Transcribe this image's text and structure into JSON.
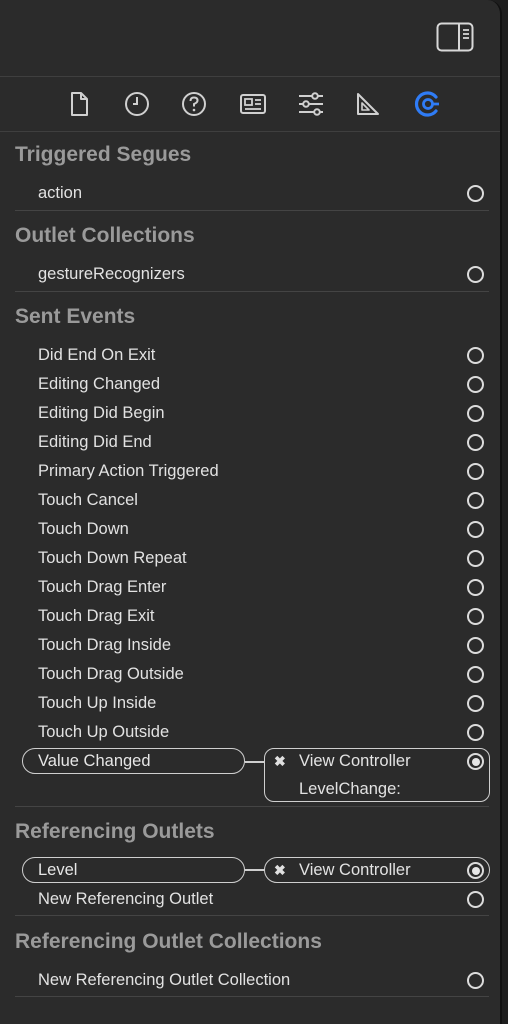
{
  "sections": {
    "triggered_segues": {
      "title": "Triggered Segues",
      "items": [
        "action"
      ]
    },
    "outlet_collections": {
      "title": "Outlet Collections",
      "items": [
        "gestureRecognizers"
      ]
    },
    "sent_events": {
      "title": "Sent Events",
      "items": [
        "Did End On Exit",
        "Editing Changed",
        "Editing Did Begin",
        "Editing Did End",
        "Primary Action Triggered",
        "Touch Cancel",
        "Touch Down",
        "Touch Down Repeat",
        "Touch Drag Enter",
        "Touch Drag Exit",
        "Touch Drag Inside",
        "Touch Drag Outside",
        "Touch Up Inside",
        "Touch Up Outside"
      ],
      "connected": {
        "label": "Value Changed",
        "target": "View Controller",
        "method": "LevelChange:",
        "remove_symbol": "✖"
      }
    },
    "referencing_outlets": {
      "title": "Referencing Outlets",
      "connected": {
        "label": "Level",
        "target": "View Controller",
        "remove_symbol": "✖"
      },
      "items": [
        "New Referencing Outlet"
      ]
    },
    "referencing_outlet_collections": {
      "title": "Referencing Outlet Collections",
      "items": [
        "New Referencing Outlet Collection"
      ]
    }
  },
  "colors": {
    "background": "#2b2b2b",
    "accent": "#2f7cf6",
    "section_title": "#9a9a9a",
    "text": "#e2e2e2"
  },
  "icons": [
    "file-inspector-icon",
    "history-inspector-icon",
    "quick-help-icon",
    "identity-inspector-icon",
    "attributes-inspector-icon",
    "size-inspector-icon",
    "connections-inspector-icon"
  ]
}
